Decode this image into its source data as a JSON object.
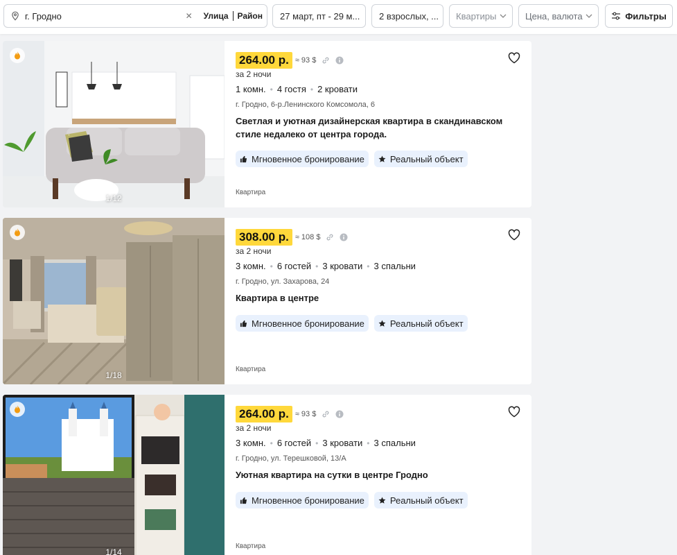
{
  "search": {
    "city": "г. Гродно",
    "street_label": "Улица",
    "district_label": "Район",
    "clear_icon": "close-icon",
    "pin_icon": "location-pin-icon"
  },
  "filters": {
    "dates": "27 март, пт - 29 м...",
    "guests": "2 взрослых, ...",
    "type_placeholder": "Квартиры",
    "price_placeholder": "Цена, валюта",
    "filters_label": "Фильтры"
  },
  "colors": {
    "price_badge": "#ffd83b",
    "tag_bg": "#e9f1fd",
    "page_bg": "#f2f3f5"
  },
  "listings": [
    {
      "price": "264.00 р.",
      "approx": "≈ 93 $",
      "nights": "за 2 ночи",
      "specs": [
        "1 комн.",
        "4 гостя",
        "2 кровати"
      ],
      "address": "г. Гродно, 6-р.Ленинского Комсомола, 6",
      "title": "Светлая и уютная дизайнерская квартира в скандинавском стиле недалеко от центра города.",
      "tags": [
        "Мгновенное бронирование",
        "Реальный объект"
      ],
      "kind": "Квартира",
      "photo_counter": "1/12"
    },
    {
      "price": "308.00 р.",
      "approx": "≈ 108 $",
      "nights": "за 2 ночи",
      "specs": [
        "3 комн.",
        "6 гостей",
        "3 кровати",
        "3 спальни"
      ],
      "address": "г. Гродно, ул. Захарова, 24",
      "title": "Квартира в центре",
      "tags": [
        "Мгновенное бронирование",
        "Реальный объект"
      ],
      "kind": "Квартира",
      "photo_counter": "1/18"
    },
    {
      "price": "264.00 р.",
      "approx": "≈ 93 $",
      "nights": "за 2 ночи",
      "specs": [
        "3 комн.",
        "6 гостей",
        "3 кровати",
        "3 спальни"
      ],
      "address": "г. Гродно, ул. Терешковой, 13/А",
      "title": "Уютная квартира на сутки в центре Гродно",
      "tags": [
        "Мгновенное бронирование",
        "Реальный объект"
      ],
      "kind": "Квартира",
      "photo_counter": "1/14"
    }
  ]
}
